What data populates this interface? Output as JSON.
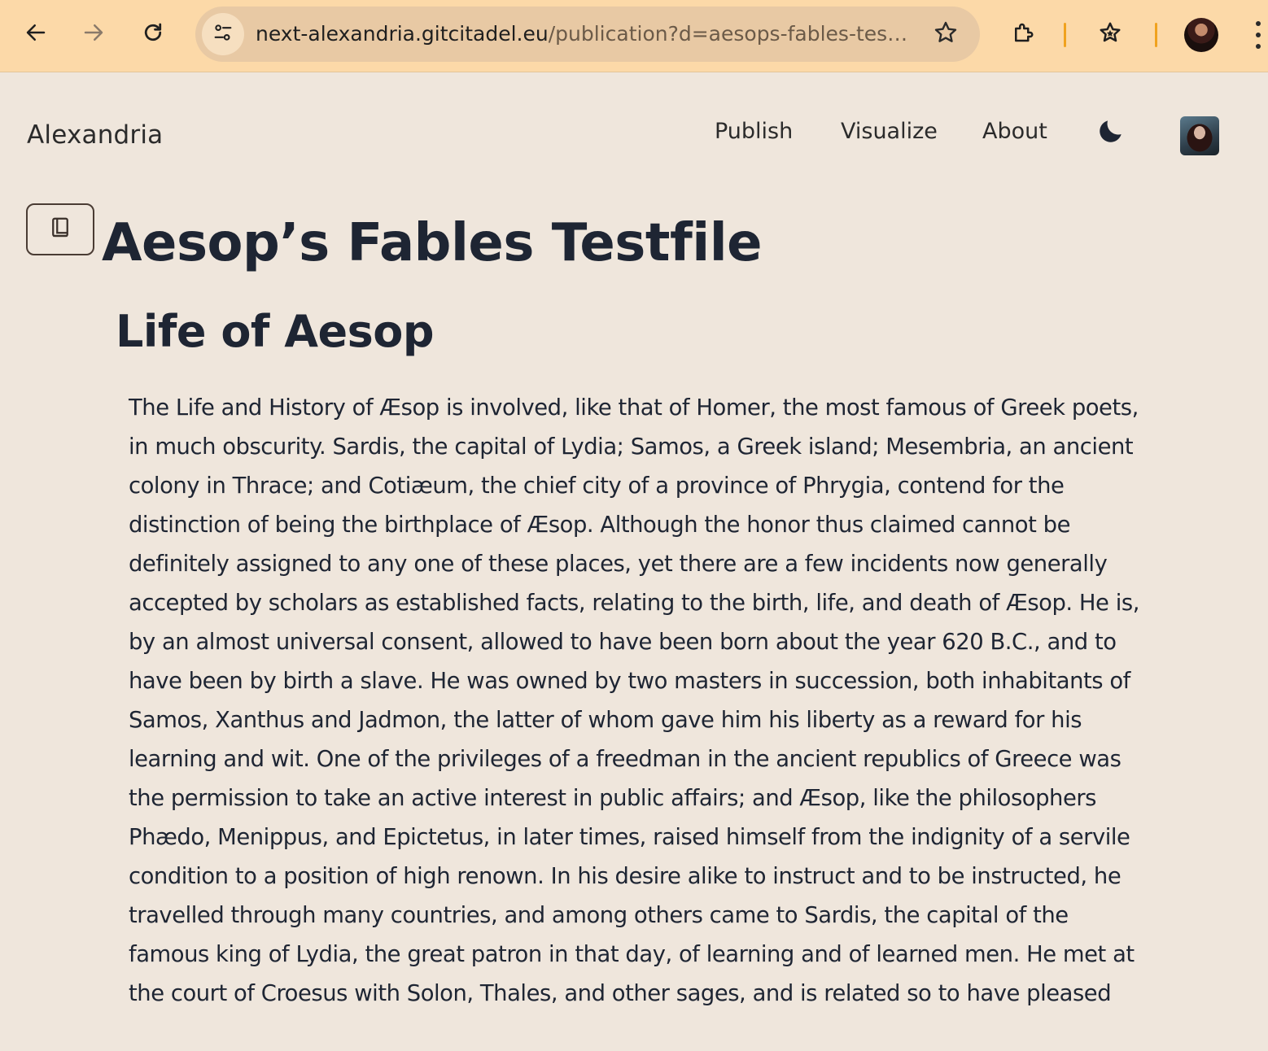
{
  "browser": {
    "url_host": "next-alexandria.gitcitadel.eu",
    "url_path": "/publication?d=aesops-fables-tes…",
    "icons": {
      "back": "arrow-left-icon",
      "forward": "arrow-right-icon",
      "reload": "reload-icon",
      "site_info": "tune-icon",
      "bookmark": "star-icon",
      "extensions": "puzzle-icon",
      "bookmarks_bar": "star-list-icon",
      "menu": "kebab-menu-icon"
    },
    "colors": {
      "toolbar": "#fcd9a8",
      "omnibox": "#e8c9a4",
      "separator": "#f0a21e"
    }
  },
  "site": {
    "brand": "Alexandria",
    "nav": [
      "Publish",
      "Visualize",
      "About"
    ],
    "theme_icon": "moon-icon",
    "background": "#efe6dc"
  },
  "publication": {
    "toc_icon": "book-icon",
    "title": "Aesop’s Fables Testfile",
    "section": {
      "heading": "Life of Aesop",
      "body": "The Life and History of Æsop is involved, like that of Homer, the most famous of Greek poets, in much obscurity. Sardis, the capital of Lydia; Samos, a Greek island; Mesembria, an ancient colony in Thrace; and Cotiæum, the chief city of a province of Phrygia, contend for the distinction of being the birthplace of Æsop. Although the honor thus claimed cannot be definitely assigned to any one of these places, yet there are a few incidents now generally accepted by scholars as established facts, relating to the birth, life, and death of Æsop. He is, by an almost universal consent, allowed to have been born about the year 620 B.C., and to have been by birth a slave. He was owned by two masters in succession, both inhabitants of Samos, Xanthus and Jadmon, the latter of whom gave him his liberty as a reward for his learning and wit. One of the privileges of a freedman in the ancient republics of Greece was the permission to take an active interest in public affairs; and Æsop, like the philosophers Phædo, Menippus, and Epictetus, in later times, raised himself from the indignity of a servile condition to a position of high renown. In his desire alike to instruct and to be instructed, he travelled through many countries, and among others came to Sardis, the capital of the famous king of Lydia, the great patron in that day, of learning and of learned men. He met at the court of Croesus with Solon, Thales, and other sages, and is related so to have pleased"
    }
  }
}
